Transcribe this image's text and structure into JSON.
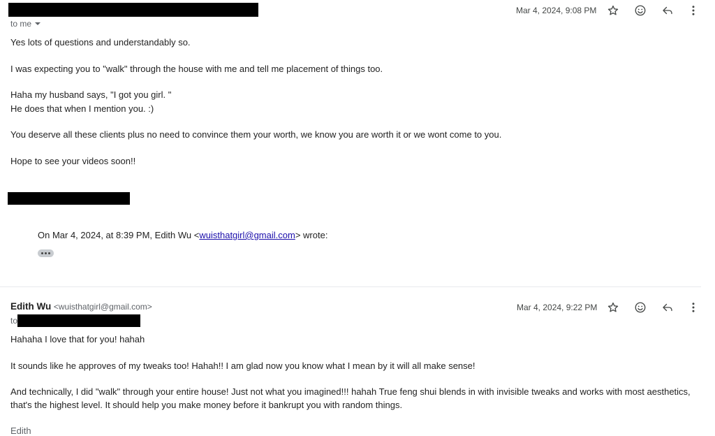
{
  "message1": {
    "date": "Mar 4, 2024, 9:08 PM",
    "to_label": "to me",
    "lines": [
      "Yes lots of questions and understandably so.",
      "I was expecting you to \"walk\" through the house with me and tell me placement of things too.",
      "Haha my husband says, \"I got you girl. \"",
      "He does that when I mention you. :)",
      "You deserve all these clients plus no need to convince them your worth, we know you are worth it or we wont come to you.",
      "Hope to see your videos soon!!"
    ],
    "quote_prefix": "On Mar 4, 2024, at 8:39 PM, Edith Wu <",
    "quote_email": "wuisthatgirl@gmail.com",
    "quote_suffix": "> wrote:"
  },
  "message2": {
    "sender_name": "Edith Wu",
    "sender_email": "<wuisthatgirl@gmail.com>",
    "date": "Mar 4, 2024, 9:22 PM",
    "to_label": "to",
    "lines": [
      "Hahaha I love that for you! hahah",
      "It sounds like he approves of my tweaks too! Hahah!! I am glad now you know what I mean by it will all make sense!",
      "And technically, I did \"walk\" through your entire house! Just not what you imagined!!! hahah True feng shui blends in with invisible tweaks and works with most aesthetics, that's the highest level. It should help you make money before it bankrupt you with random things."
    ],
    "signature": "Edith"
  },
  "icons": [
    "star-icon",
    "emoji-icon",
    "reply-icon",
    "more-vert-icon",
    "chevron-down-icon",
    "ellipsis-icon"
  ]
}
